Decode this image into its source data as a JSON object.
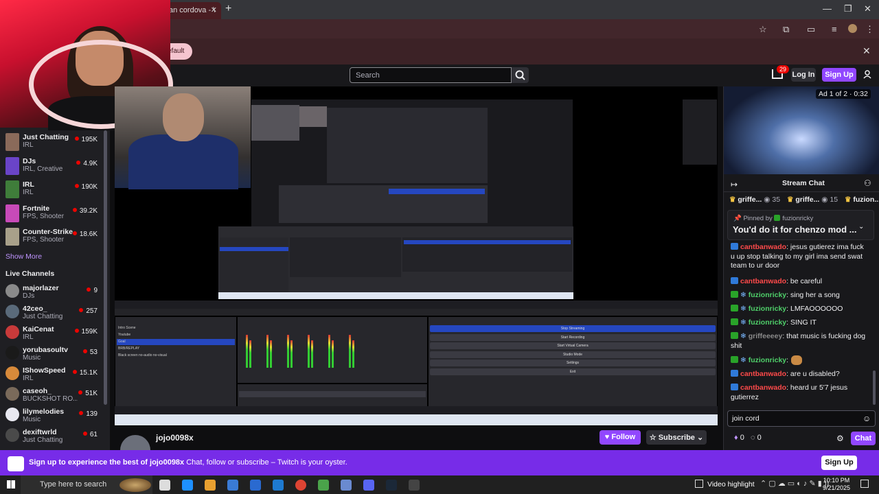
{
  "browser": {
    "tab_title": "an cordova - \\",
    "banner_pill": "efault"
  },
  "nav": {
    "search_placeholder": "Search",
    "notification_count": "29",
    "login": "Log In",
    "signup": "Sign Up"
  },
  "sidebar": {
    "categories": [
      {
        "name": "Just Chatting",
        "category": "IRL",
        "viewers": "195K",
        "color": "#8a6a5a"
      },
      {
        "name": "DJs",
        "category": "IRL, Creative",
        "viewers": "4.9K",
        "color": "#6a44c8"
      },
      {
        "name": "IRL",
        "category": "IRL",
        "viewers": "190K",
        "color": "#3f7d3a"
      },
      {
        "name": "Fortnite",
        "category": "FPS, Shooter",
        "viewers": "39.2K",
        "color": "#c84ab8"
      },
      {
        "name": "Counter-Strike",
        "category": "FPS, Shooter",
        "viewers": "18.6K",
        "color": "#a8a08a"
      }
    ],
    "show_more": "Show More",
    "live_channels_header": "Live Channels",
    "live": [
      {
        "name": "majorlazer",
        "category": "DJs",
        "viewers": "9",
        "color": "#8a8a8a"
      },
      {
        "name": "42ceo_",
        "category": "Just Chatting",
        "viewers": "257",
        "color": "#5a6a7a"
      },
      {
        "name": "KaiCenat",
        "category": "IRL",
        "viewers": "159K",
        "color": "#c83a3a"
      },
      {
        "name": "yorubasoultv",
        "category": "Music",
        "viewers": "53",
        "color": "#1a1a1a"
      },
      {
        "name": "IShowSpeed",
        "category": "IRL",
        "viewers": "15.1K",
        "color": "#d88a3a"
      },
      {
        "name": "caseoh_",
        "category": "BUCKSHOT RO...",
        "viewers": "51K",
        "color": "#7a6a5a"
      },
      {
        "name": "lilymelodies",
        "category": "Music",
        "viewers": "139",
        "color": "#e8e8f0"
      },
      {
        "name": "dexiftwrld",
        "category": "Just Chatting",
        "viewers": "61",
        "color": "#4a4a4a"
      }
    ]
  },
  "obs": {
    "scenes": [
      "Intro Scene",
      "Youtube",
      "Goal",
      "BRB/REPLAY",
      "Black screen no-audio no-visual"
    ],
    "controls": [
      "Stop Streaming",
      "Start Recording",
      "Start Virtual Camera",
      "Studio Mode",
      "Settings",
      "Exit"
    ]
  },
  "stream": {
    "channel": "jojo0098x",
    "follow": "Follow",
    "subscribe": "Subscribe"
  },
  "chat": {
    "ad_label": "Ad 1 of 2 · 0:32",
    "title": "Stream Chat",
    "gifts": [
      {
        "user": "griffe...",
        "count": "35"
      },
      {
        "user": "griffe...",
        "count": "15"
      },
      {
        "user": "fuzion...",
        "count": ""
      }
    ],
    "pinned_by": "Pinned by",
    "pinned_user": "fuzionricky",
    "pinned_message": "You'd do it for chenzo mod ...",
    "messages": [
      {
        "user": "cantbanwado",
        "color": "#ff4a4a",
        "badge": "#2f7ad9",
        "text": ": jesus gutierez ima fuck u up stop talking to my girl ima send swat team to ur door"
      },
      {
        "user": "cantbanwado",
        "color": "#ff4a4a",
        "badge": "#2f7ad9",
        "text": ": be careful"
      },
      {
        "user": "fuzionricky",
        "color": "#4fd06a",
        "badge": "#29a329",
        "text": ": sing her a song"
      },
      {
        "user": "fuzionricky",
        "color": "#4fd06a",
        "badge": "#29a329",
        "text": ": LMFAOOOOOO"
      },
      {
        "user": "fuzionricky",
        "color": "#4fd06a",
        "badge": "#29a329",
        "text": ": SING IT"
      },
      {
        "user": "griffeeeey",
        "color": "#8a8a8a",
        "badge": "#29a329",
        "text": ": that music is fucking dog shit"
      },
      {
        "user": "fuzionricky",
        "color": "#4fd06a",
        "badge": "#29a329",
        "text": ":"
      },
      {
        "user": "cantbanwado",
        "color": "#ff4a4a",
        "badge": "#2f7ad9",
        "text": ": are u disabled?"
      },
      {
        "user": "cantbanwado",
        "color": "#ff4a4a",
        "badge": "#2f7ad9",
        "text": ": heard ur 5'7 jesus gutierrez"
      }
    ],
    "input_value": "join cord",
    "points": "0",
    "points2": "0",
    "chat_button": "Chat"
  },
  "promo": {
    "bold": "Sign up to experience the best of jojo0098x",
    "rest": " Chat, follow or subscribe – Twitch is your oyster.",
    "button": "Sign Up"
  },
  "taskbar": {
    "search_placeholder": "Type here to search",
    "video_highlight": "Video highlight",
    "time": "10:10 PM",
    "date": "9/21/2025"
  }
}
